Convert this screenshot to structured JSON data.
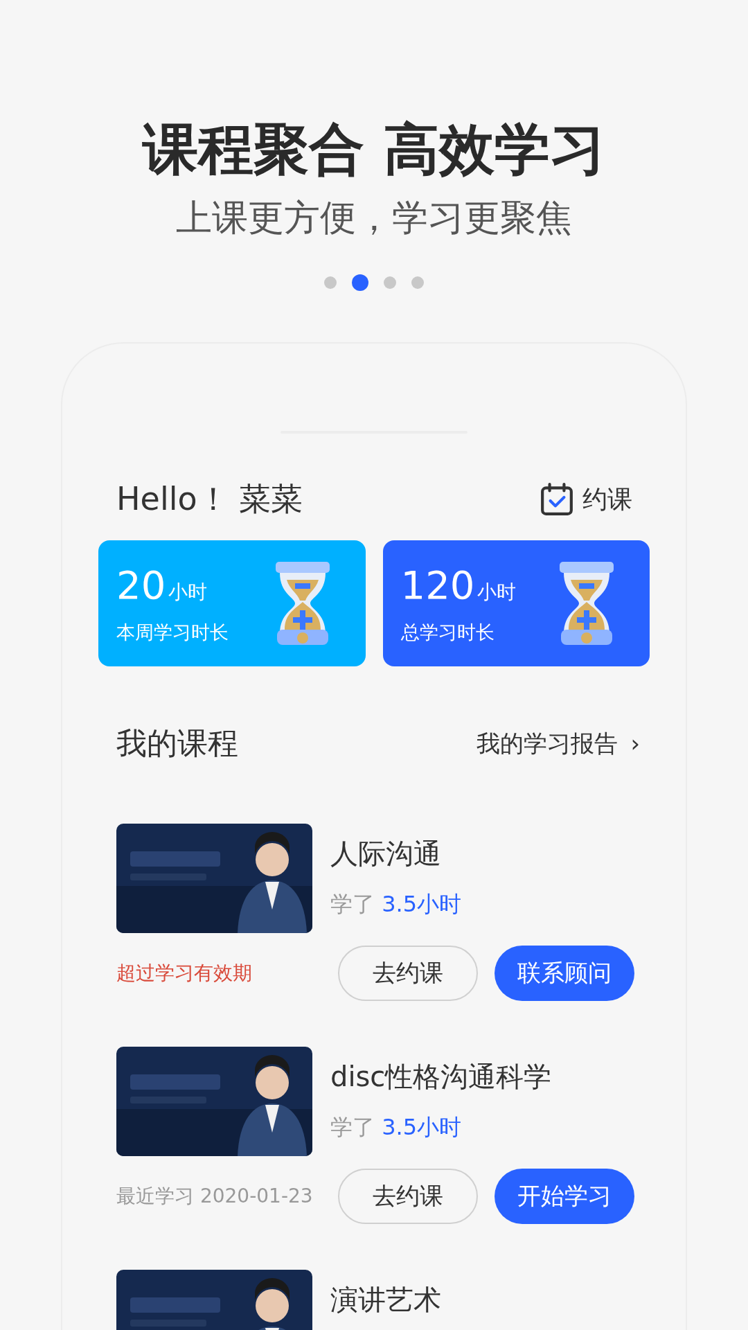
{
  "headline": "课程聚合 高效学习",
  "subheadline": "上课更方便，学习更聚焦",
  "pager": [
    {
      "selected": false
    },
    {
      "selected": true
    },
    {
      "selected": false
    },
    {
      "selected": false
    }
  ],
  "greeting": "Hello！ 菜菜",
  "book_link": "约课",
  "stats": [
    {
      "value": "20",
      "unit": "小时",
      "label": "本周学习时长",
      "color": "#00b0ff"
    },
    {
      "value": "120",
      "unit": "小时",
      "label": "总学习时长",
      "color": "#2962ff"
    }
  ],
  "section_title": "我的课程",
  "report_link": "我的学习报告",
  "report_arrow": "›",
  "courses": [
    {
      "title": "人际沟通",
      "progress_label": "学了",
      "progress_value": "3.5小时",
      "status": {
        "kind": "expired",
        "text": "超过学习有效期"
      },
      "buttons": [
        {
          "kind": "outline",
          "label": "去约课"
        },
        {
          "kind": "primary",
          "label": "联系顾问"
        }
      ]
    },
    {
      "title": "disc性格沟通科学",
      "progress_label": "学了",
      "progress_value": "3.5小时",
      "status": {
        "kind": "recent",
        "text": "最近学习 2020-01-23"
      },
      "buttons": [
        {
          "kind": "outline",
          "label": "去约课"
        },
        {
          "kind": "primary",
          "label": "开始学习"
        }
      ]
    },
    {
      "title": "演讲艺术"
    }
  ]
}
